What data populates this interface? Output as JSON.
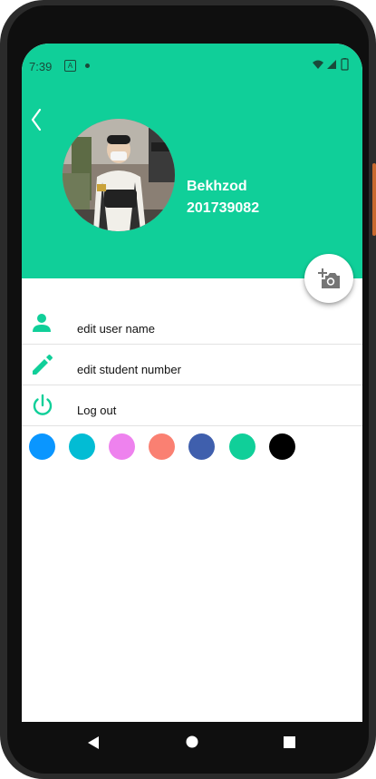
{
  "status_bar": {
    "time": "7:39",
    "app_indicator": "A"
  },
  "profile": {
    "name": "Bekhzod",
    "student_number": "201739082"
  },
  "menu": {
    "items": [
      {
        "label": "edit user name",
        "icon": "person-icon"
      },
      {
        "label": "edit student number",
        "icon": "pencil-icon"
      },
      {
        "label": "Log out",
        "icon": "power-icon"
      }
    ]
  },
  "theme_colors": [
    "#0a96ff",
    "#02bcd4",
    "#ee82ee",
    "#fa8072",
    "#3f5fad",
    "#10cf99",
    "#000000"
  ],
  "colors": {
    "accent": "#10cf99",
    "icon": "#10cf99",
    "fab_icon": "#757575"
  }
}
